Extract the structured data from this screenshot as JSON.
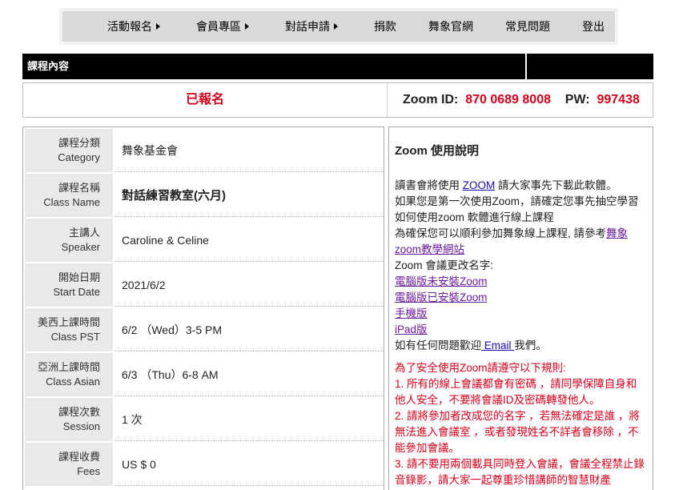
{
  "nav": {
    "items": [
      {
        "label": "活動報名",
        "has_caret": true
      },
      {
        "label": "會員專區",
        "has_caret": true
      },
      {
        "label": "對話申請",
        "has_caret": true
      },
      {
        "label": "捐款",
        "has_caret": false
      },
      {
        "label": "舞象官網",
        "has_caret": false
      },
      {
        "label": "常見問題",
        "has_caret": false
      },
      {
        "label": "登出",
        "has_caret": false
      }
    ]
  },
  "header": {
    "title": "課程內容"
  },
  "status": {
    "registered": "已報名",
    "zoom_id_label": "Zoom ID:",
    "zoom_id_value": "870 0689 8008",
    "pw_label": "PW:",
    "pw_value": "997438"
  },
  "info": {
    "rows": [
      {
        "label_zh": "課程分類",
        "label_en": "Category",
        "value": "舞象基金會"
      },
      {
        "label_zh": "課程名稱",
        "label_en": "Class Name",
        "value": "對話練習教室(六月)"
      },
      {
        "label_zh": "主講人",
        "label_en": "Speaker",
        "value": "Caroline & Celine"
      },
      {
        "label_zh": "開始日期",
        "label_en": "Start Date",
        "value": "2021/6/2"
      },
      {
        "label_zh": "美西上課時間",
        "label_en": "Class PST",
        "value": "6/2 （Wed）3-5 PM"
      },
      {
        "label_zh": "亞洲上課時間",
        "label_en": "Class Asian",
        "value": "6/3 （Thu）6-8 AM"
      },
      {
        "label_zh": "課程次數",
        "label_en": "Session",
        "value": "1 次"
      },
      {
        "label_zh": "課程收費",
        "label_en": "Fees",
        "value": "US $ 0"
      }
    ]
  },
  "zoom_panel": {
    "title": "Zoom 使用說明",
    "line1_pre": "讀書會將使用 ",
    "line1_link": "ZOOM",
    "line1_post": " 請大家事先下載此軟體。",
    "line2": "如果您是第一次使用Zoom，請確定您事先抽空學習如何使用zoom 軟體進行線上課程",
    "line3_pre": "為確保您可以順利參加舞象線上課程, 請參考",
    "line3_link": "舞象zoom教學網站",
    "line4": "Zoom 會議更改名字:",
    "link_pc_no_zoom": "電腦版未安裝Zoom",
    "link_pc_zoom": "電腦版已安裝Zoom",
    "link_mobile": "手機版",
    "link_ipad": "iPad版",
    "contact_pre": "如有任何問題歡迎",
    "contact_link": " Email ",
    "contact_post": "我們。",
    "rules_title": "為了安全使用Zoom請遵守以下規則:",
    "rule1": "1. 所有的線上會議都會有密碼 ，請同學保障自身和他人安全，不要將會議ID及密碼轉發他人。",
    "rule2": "2. 請將參加者改成您的名字 ，若無法確定是誰 ，將無法進入會議室 ，或者發現姓名不詳者會移除 ，不能參加會議。",
    "rule3": "3. 請不要用兩個載具同時登入會議，會議全程禁止錄音錄影，請大家一起尊重珍惜講師的智慧財產"
  }
}
